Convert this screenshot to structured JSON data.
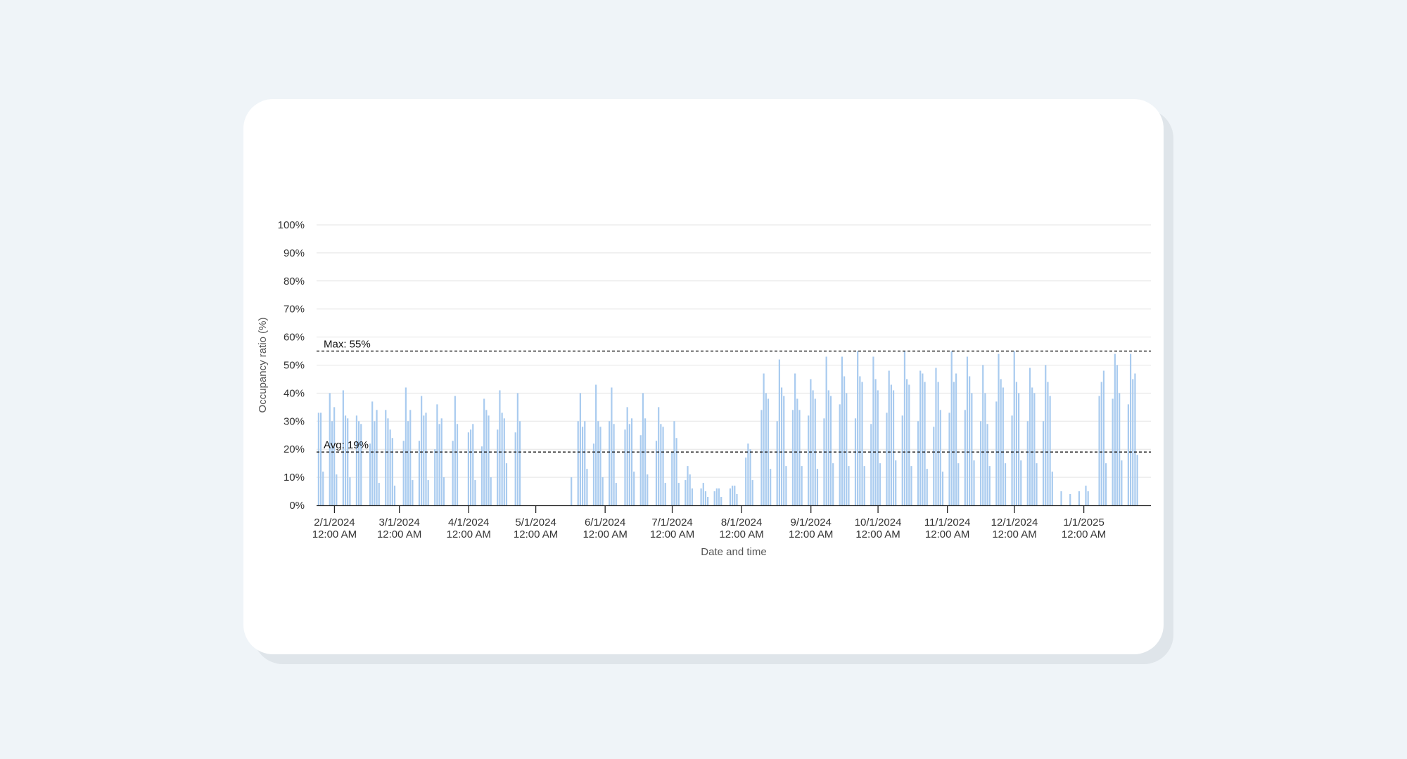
{
  "chart_data": {
    "type": "bar",
    "title": "",
    "xlabel": "Date and time",
    "ylabel": "Occupancy ratio (%)",
    "ylim": [
      0,
      100
    ],
    "yticks": [
      "0%",
      "10%",
      "20%",
      "30%",
      "40%",
      "50%",
      "60%",
      "70%",
      "80%",
      "90%",
      "100%"
    ],
    "xlim": [
      "2024-01-24",
      "2025-01-31"
    ],
    "xticks": [
      {
        "date": "2024-02-01",
        "line1": "2/1/2024",
        "line2": "12:00 AM"
      },
      {
        "date": "2024-03-01",
        "line1": "3/1/2024",
        "line2": "12:00 AM"
      },
      {
        "date": "2024-04-01",
        "line1": "4/1/2024",
        "line2": "12:00 AM"
      },
      {
        "date": "2024-05-01",
        "line1": "5/1/2024",
        "line2": "12:00 AM"
      },
      {
        "date": "2024-06-01",
        "line1": "6/1/2024",
        "line2": "12:00 AM"
      },
      {
        "date": "2024-07-01",
        "line1": "7/1/2024",
        "line2": "12:00 AM"
      },
      {
        "date": "2024-08-01",
        "line1": "8/1/2024",
        "line2": "12:00 AM"
      },
      {
        "date": "2024-09-01",
        "line1": "9/1/2024",
        "line2": "12:00 AM"
      },
      {
        "date": "2024-10-01",
        "line1": "10/1/2024",
        "line2": "12:00 AM"
      },
      {
        "date": "2024-11-01",
        "line1": "11/1/2024",
        "line2": "12:00 AM"
      },
      {
        "date": "2024-12-01",
        "line1": "12/1/2024",
        "line2": "12:00 AM"
      },
      {
        "date": "2025-01-01",
        "line1": "1/1/2025",
        "line2": "12:00 AM"
      }
    ],
    "reference_lines": [
      {
        "label": "Max: 55%",
        "value": 55
      },
      {
        "label": "Avg: 19%",
        "value": 19
      }
    ],
    "bar_color": "#a9cbef",
    "grid": true,
    "series": [
      {
        "points": [
          [
            "2024-01-25",
            33
          ],
          [
            "2024-01-26",
            33
          ],
          [
            "2024-01-27",
            12
          ],
          [
            "2024-01-30",
            40
          ],
          [
            "2024-01-31",
            30
          ],
          [
            "2024-02-01",
            35
          ],
          [
            "2024-02-02",
            11
          ],
          [
            "2024-02-05",
            41
          ],
          [
            "2024-02-06",
            32
          ],
          [
            "2024-02-07",
            31
          ],
          [
            "2024-02-08",
            10
          ],
          [
            "2024-02-11",
            32
          ],
          [
            "2024-02-12",
            30
          ],
          [
            "2024-02-13",
            29
          ],
          [
            "2024-02-17",
            22
          ],
          [
            "2024-02-18",
            37
          ],
          [
            "2024-02-19",
            30
          ],
          [
            "2024-02-20",
            34
          ],
          [
            "2024-02-21",
            8
          ],
          [
            "2024-02-24",
            34
          ],
          [
            "2024-02-25",
            31
          ],
          [
            "2024-02-26",
            27
          ],
          [
            "2024-02-27",
            24
          ],
          [
            "2024-02-28",
            7
          ],
          [
            "2024-03-03",
            23
          ],
          [
            "2024-03-04",
            42
          ],
          [
            "2024-03-05",
            30
          ],
          [
            "2024-03-06",
            34
          ],
          [
            "2024-03-07",
            9
          ],
          [
            "2024-03-10",
            23
          ],
          [
            "2024-03-11",
            39
          ],
          [
            "2024-03-12",
            32
          ],
          [
            "2024-03-13",
            33
          ],
          [
            "2024-03-14",
            9
          ],
          [
            "2024-03-17",
            20
          ],
          [
            "2024-03-18",
            36
          ],
          [
            "2024-03-19",
            29
          ],
          [
            "2024-03-20",
            31
          ],
          [
            "2024-03-21",
            10
          ],
          [
            "2024-03-25",
            23
          ],
          [
            "2024-03-26",
            39
          ],
          [
            "2024-03-27",
            29
          ],
          [
            "2024-04-01",
            26
          ],
          [
            "2024-04-02",
            27
          ],
          [
            "2024-04-03",
            29
          ],
          [
            "2024-04-04",
            9
          ],
          [
            "2024-04-07",
            21
          ],
          [
            "2024-04-08",
            38
          ],
          [
            "2024-04-09",
            34
          ],
          [
            "2024-04-10",
            32
          ],
          [
            "2024-04-11",
            10
          ],
          [
            "2024-04-14",
            27
          ],
          [
            "2024-04-15",
            41
          ],
          [
            "2024-04-16",
            33
          ],
          [
            "2024-04-17",
            31
          ],
          [
            "2024-04-18",
            15
          ],
          [
            "2024-04-22",
            26
          ],
          [
            "2024-04-23",
            40
          ],
          [
            "2024-04-24",
            30
          ],
          [
            "2024-05-17",
            10
          ],
          [
            "2024-05-20",
            30
          ],
          [
            "2024-05-21",
            40
          ],
          [
            "2024-05-22",
            28
          ],
          [
            "2024-05-23",
            30
          ],
          [
            "2024-05-24",
            13
          ],
          [
            "2024-05-27",
            22
          ],
          [
            "2024-05-28",
            43
          ],
          [
            "2024-05-29",
            30
          ],
          [
            "2024-05-30",
            28
          ],
          [
            "2024-05-31",
            10
          ],
          [
            "2024-06-03",
            30
          ],
          [
            "2024-06-04",
            42
          ],
          [
            "2024-06-05",
            29
          ],
          [
            "2024-06-06",
            8
          ],
          [
            "2024-06-10",
            27
          ],
          [
            "2024-06-11",
            35
          ],
          [
            "2024-06-12",
            29
          ],
          [
            "2024-06-13",
            31
          ],
          [
            "2024-06-14",
            12
          ],
          [
            "2024-06-17",
            25
          ],
          [
            "2024-06-18",
            40
          ],
          [
            "2024-06-19",
            31
          ],
          [
            "2024-06-20",
            11
          ],
          [
            "2024-06-24",
            23
          ],
          [
            "2024-06-25",
            35
          ],
          [
            "2024-06-26",
            29
          ],
          [
            "2024-06-27",
            28
          ],
          [
            "2024-06-28",
            8
          ],
          [
            "2024-07-01",
            19
          ],
          [
            "2024-07-02",
            30
          ],
          [
            "2024-07-03",
            24
          ],
          [
            "2024-07-04",
            8
          ],
          [
            "2024-07-07",
            9
          ],
          [
            "2024-07-08",
            14
          ],
          [
            "2024-07-09",
            11
          ],
          [
            "2024-07-10",
            6
          ],
          [
            "2024-07-14",
            6
          ],
          [
            "2024-07-15",
            8
          ],
          [
            "2024-07-16",
            5
          ],
          [
            "2024-07-17",
            3
          ],
          [
            "2024-07-20",
            5
          ],
          [
            "2024-07-21",
            6
          ],
          [
            "2024-07-22",
            6
          ],
          [
            "2024-07-23",
            3
          ],
          [
            "2024-07-27",
            6
          ],
          [
            "2024-07-28",
            7
          ],
          [
            "2024-07-29",
            7
          ],
          [
            "2024-07-30",
            4
          ],
          [
            "2024-08-03",
            17
          ],
          [
            "2024-08-04",
            22
          ],
          [
            "2024-08-05",
            20
          ],
          [
            "2024-08-06",
            9
          ],
          [
            "2024-08-10",
            34
          ],
          [
            "2024-08-11",
            47
          ],
          [
            "2024-08-12",
            40
          ],
          [
            "2024-08-13",
            38
          ],
          [
            "2024-08-14",
            13
          ],
          [
            "2024-08-17",
            30
          ],
          [
            "2024-08-18",
            52
          ],
          [
            "2024-08-19",
            42
          ],
          [
            "2024-08-20",
            39
          ],
          [
            "2024-08-21",
            14
          ],
          [
            "2024-08-24",
            34
          ],
          [
            "2024-08-25",
            47
          ],
          [
            "2024-08-26",
            38
          ],
          [
            "2024-08-27",
            34
          ],
          [
            "2024-08-28",
            14
          ],
          [
            "2024-08-31",
            32
          ],
          [
            "2024-09-01",
            45
          ],
          [
            "2024-09-02",
            41
          ],
          [
            "2024-09-03",
            38
          ],
          [
            "2024-09-04",
            13
          ],
          [
            "2024-09-07",
            31
          ],
          [
            "2024-09-08",
            53
          ],
          [
            "2024-09-09",
            41
          ],
          [
            "2024-09-10",
            39
          ],
          [
            "2024-09-11",
            15
          ],
          [
            "2024-09-14",
            36
          ],
          [
            "2024-09-15",
            53
          ],
          [
            "2024-09-16",
            46
          ],
          [
            "2024-09-17",
            40
          ],
          [
            "2024-09-18",
            14
          ],
          [
            "2024-09-21",
            31
          ],
          [
            "2024-09-22",
            55
          ],
          [
            "2024-09-23",
            46
          ],
          [
            "2024-09-24",
            44
          ],
          [
            "2024-09-25",
            14
          ],
          [
            "2024-09-28",
            29
          ],
          [
            "2024-09-29",
            53
          ],
          [
            "2024-09-30",
            45
          ],
          [
            "2024-10-01",
            41
          ],
          [
            "2024-10-02",
            15
          ],
          [
            "2024-10-05",
            33
          ],
          [
            "2024-10-06",
            48
          ],
          [
            "2024-10-07",
            43
          ],
          [
            "2024-10-08",
            41
          ],
          [
            "2024-10-09",
            16
          ],
          [
            "2024-10-12",
            32
          ],
          [
            "2024-10-13",
            55
          ],
          [
            "2024-10-14",
            45
          ],
          [
            "2024-10-15",
            43
          ],
          [
            "2024-10-16",
            14
          ],
          [
            "2024-10-19",
            30
          ],
          [
            "2024-10-20",
            48
          ],
          [
            "2024-10-21",
            47
          ],
          [
            "2024-10-22",
            44
          ],
          [
            "2024-10-23",
            13
          ],
          [
            "2024-10-26",
            28
          ],
          [
            "2024-10-27",
            49
          ],
          [
            "2024-10-28",
            44
          ],
          [
            "2024-10-29",
            34
          ],
          [
            "2024-10-30",
            12
          ],
          [
            "2024-11-02",
            33
          ],
          [
            "2024-11-03",
            55
          ],
          [
            "2024-11-04",
            44
          ],
          [
            "2024-11-05",
            47
          ],
          [
            "2024-11-06",
            15
          ],
          [
            "2024-11-09",
            34
          ],
          [
            "2024-11-10",
            53
          ],
          [
            "2024-11-11",
            46
          ],
          [
            "2024-11-12",
            40
          ],
          [
            "2024-11-13",
            16
          ],
          [
            "2024-11-16",
            30
          ],
          [
            "2024-11-17",
            50
          ],
          [
            "2024-11-18",
            40
          ],
          [
            "2024-11-19",
            29
          ],
          [
            "2024-11-20",
            14
          ],
          [
            "2024-11-23",
            37
          ],
          [
            "2024-11-24",
            54
          ],
          [
            "2024-11-25",
            45
          ],
          [
            "2024-11-26",
            42
          ],
          [
            "2024-11-27",
            15
          ],
          [
            "2024-11-30",
            32
          ],
          [
            "2024-12-01",
            55
          ],
          [
            "2024-12-02",
            44
          ],
          [
            "2024-12-03",
            40
          ],
          [
            "2024-12-04",
            16
          ],
          [
            "2024-12-07",
            30
          ],
          [
            "2024-12-08",
            49
          ],
          [
            "2024-12-09",
            42
          ],
          [
            "2024-12-10",
            40
          ],
          [
            "2024-12-11",
            15
          ],
          [
            "2024-12-14",
            30
          ],
          [
            "2024-12-15",
            50
          ],
          [
            "2024-12-16",
            44
          ],
          [
            "2024-12-17",
            39
          ],
          [
            "2024-12-18",
            12
          ],
          [
            "2024-12-22",
            5
          ],
          [
            "2024-12-26",
            4
          ],
          [
            "2024-12-30",
            5
          ],
          [
            "2025-01-02",
            7
          ],
          [
            "2025-01-03",
            5
          ],
          [
            "2025-01-08",
            39
          ],
          [
            "2025-01-09",
            44
          ],
          [
            "2025-01-10",
            48
          ],
          [
            "2025-01-11",
            15
          ],
          [
            "2025-01-14",
            38
          ],
          [
            "2025-01-15",
            54
          ],
          [
            "2025-01-16",
            50
          ],
          [
            "2025-01-17",
            40
          ],
          [
            "2025-01-18",
            16
          ],
          [
            "2025-01-21",
            36
          ],
          [
            "2025-01-22",
            54
          ],
          [
            "2025-01-23",
            45
          ],
          [
            "2025-01-24",
            47
          ],
          [
            "2025-01-25",
            18
          ]
        ]
      }
    ]
  }
}
